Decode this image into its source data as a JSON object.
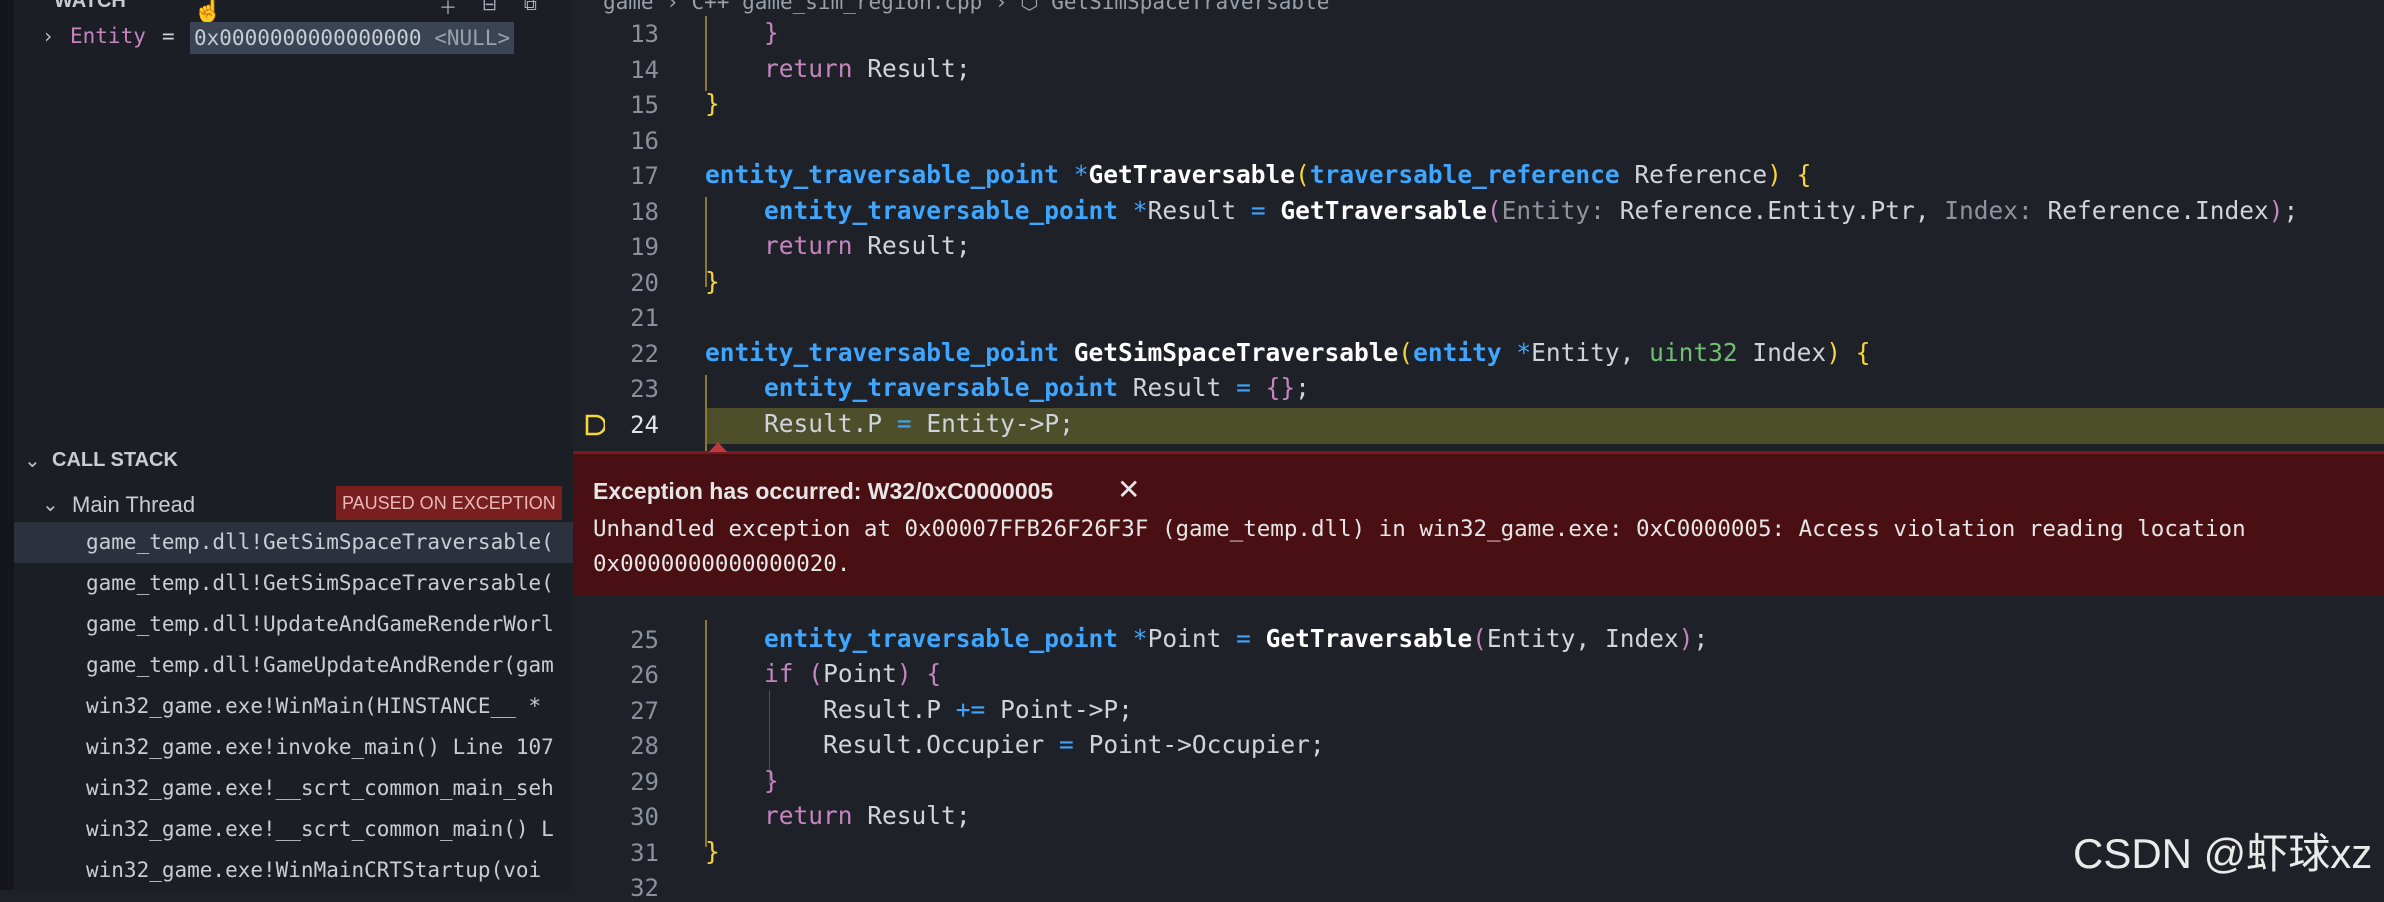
{
  "watch": {
    "title": "WATCH",
    "expression": {
      "name": "Entity",
      "equals": "=",
      "value": "0x0000000000000000",
      "value_suffix": "<NULL>"
    }
  },
  "call_stack": {
    "title": "CALL STACK",
    "thread": {
      "label": "Main Thread",
      "status": "PAUSED ON EXCEPTION"
    },
    "frames": [
      "game_temp.dll!GetSimSpaceTraversable(",
      "game_temp.dll!GetSimSpaceTraversable(",
      "game_temp.dll!UpdateAndGameRenderWorl",
      "game_temp.dll!GameUpdateAndRender(gam",
      "win32_game.exe!WinMain(HINSTANCE__ *",
      "win32_game.exe!invoke_main() Line 107",
      "win32_game.exe!__scrt_common_main_seh",
      "win32_game.exe!__scrt_common_main() L",
      "win32_game.exe!WinMainCRTStartup(voi"
    ]
  },
  "editor": {
    "breadcrumb": "game  ›  C++  game_sim_region.cpp  ›  ⬡ GetSimSpaceTraversable",
    "current_line": "24",
    "lines": {
      "l13": "13",
      "l14": "14",
      "l15": "15",
      "l16": "16",
      "l17": "17",
      "l18": "18",
      "l19": "19",
      "l20": "20",
      "l21": "21",
      "l22": "22",
      "l23": "23",
      "l24": "24",
      "l25": "25",
      "l26": "26",
      "l27": "27",
      "l28": "28",
      "l29": "29",
      "l30": "30",
      "l31": "31",
      "l32": "32"
    },
    "code": {
      "result": "Result",
      "return": "return",
      "if": "if",
      "type_point": "entity_traversable_point",
      "type_ref": "traversable_reference",
      "type_entity": "entity",
      "type_u32": "uint32",
      "fn_get": "GetTraversable",
      "fn_getsim": "GetSimSpaceTraversable",
      "p_reference": "Reference",
      "p_entity": "Entity",
      "p_index": "Index",
      "hint_entity": "Entity:",
      "hint_index": "Index:",
      "expr_ref_ptr": "Reference.Entity.Ptr",
      "expr_ref_idx": "Reference.Index",
      "expr_entity_p": "Entity->P",
      "expr_result_p": "Result.P",
      "v_point": "Point",
      "expr_point_p": "Point->P",
      "expr_result_occ": "Result.Occupier",
      "expr_point_occ": "Point->Occupier"
    }
  },
  "exception": {
    "title": "Exception has occurred: W32/0xC0000005",
    "close": "✕",
    "message": "Unhandled exception at 0x00007FFB26F26F3F (game_temp.dll) in win32_game.exe: 0xC0000005: Access violation reading location 0x0000000000000020."
  },
  "watermark": "CSDN @虾球xz",
  "icons": [
    "chevron-right-icon",
    "chevron-down-icon",
    "add-icon",
    "collapse-icon",
    "copy-icon",
    "mouse-cursor-icon",
    "close-icon",
    "breakpoint-exception-icon",
    "cpp-file-icon",
    "method-icon"
  ]
}
